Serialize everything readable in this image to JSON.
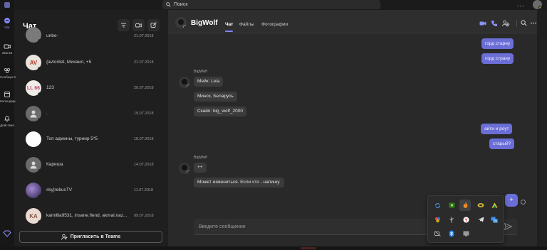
{
  "window": {
    "search_placeholder": "Поиск",
    "more": "..."
  },
  "rail": {
    "items": [
      {
        "label": "Чат",
        "icon": "chat-icon",
        "active": true
      },
      {
        "label": "Звонки",
        "icon": "video-icon",
        "active": false
      },
      {
        "label": "Сообщества",
        "icon": "community-icon",
        "active": false
      },
      {
        "label": "Календарь",
        "icon": "calendar-icon",
        "active": false
      },
      {
        "label": "Действия",
        "icon": "bell-icon",
        "active": false
      }
    ],
    "bottom_icon": "diamond-icon"
  },
  "chatlist": {
    "title": "Чат",
    "buttons": [
      "filter-icon",
      "video-call-icon",
      "compose-icon"
    ],
    "chats": [
      {
        "name": "unbe-",
        "date": "21.07.2018",
        "avatar_text": ""
      },
      {
        "name": "{avtoritet, Михаил, +5",
        "date": "21.07.2018",
        "avatar_text": "AV"
      },
      {
        "name": "123",
        "date": "20.07.2018",
        "avatar_text": "LL 66"
      },
      {
        "name": ".",
        "date": "19.07.2018",
        "avatar_text": ""
      },
      {
        "name": "Топ админы, турнир 5*5",
        "date": "18.07.2018",
        "avatar_text": ""
      },
      {
        "name": "Кариша",
        "date": "14.07.2018",
        "avatar_text": ""
      },
      {
        "name": "sky]rebusTV",
        "date": "11.07.2018",
        "avatar_text": ""
      },
      {
        "name": "kamillia9531, insane.fiend, akmal.naz...",
        "date": "09.07.2018",
        "avatar_text": "KA"
      }
    ],
    "invite_label": "Пригласить в Teams"
  },
  "conversation": {
    "name": "BigWolf",
    "tabs": [
      "Чат",
      "Файлы",
      "Фотографии"
    ],
    "active_tab": 0,
    "header_icons": [
      "video-icon",
      "phone-icon",
      "add-people-icon",
      "search-icon",
      "more-icon"
    ],
    "outgoing_top": [
      "горд старну",
      "горд страну"
    ],
    "group1": {
      "sender": "BigWolf",
      "messages": [
        "Мейк: Leia",
        "Минск, Беларусь",
        "Скайп: big_wolf_2000"
      ]
    },
    "outgoing_mid": [
      "айти и роут",
      "старый?"
    ],
    "group2": {
      "sender": "BigWolf",
      "messages": [
        "++",
        "Может измениться. Если что - напишу."
      ]
    },
    "compose_placeholder": "Введите сообщение",
    "plus_label": "+"
  },
  "tray": {
    "icons": [
      "sync-icon",
      "nvidia-icon",
      "flame-icon",
      "app-icon",
      "drive-icon",
      "color-icon",
      "usb-icon",
      "yandex-icon",
      "telegram-icon",
      "network-icon",
      "mute-icon",
      "bluetooth-icon",
      "monitor-icon"
    ]
  },
  "colors": {
    "accent": "#6a6ed6",
    "accent_light": "#7f85f5",
    "background": "#1f1f1f"
  }
}
